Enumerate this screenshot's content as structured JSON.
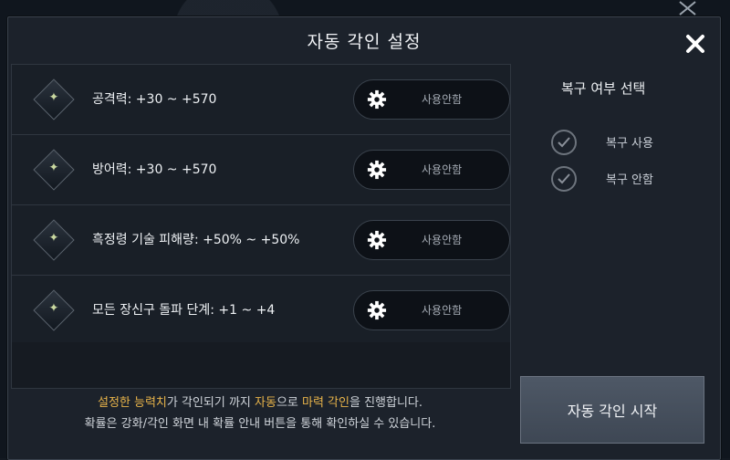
{
  "dialog": {
    "title": "자동 각인 설정",
    "close_icon": "close-icon"
  },
  "stats": [
    {
      "label": "공격력:  +30 ~  +570",
      "toggle_label": "사용안함"
    },
    {
      "label": "방어력:  +30 ~  +570",
      "toggle_label": "사용안함"
    },
    {
      "label": "흑정령 기술 피해량:  +50% ~  +50%",
      "toggle_label": "사용안함"
    },
    {
      "label": "모든 장신구 돌파 단계:  +1 ~  +4",
      "toggle_label": "사용안함"
    }
  ],
  "restore": {
    "title": "복구 여부 선택",
    "options": [
      {
        "label": "복구 사용"
      },
      {
        "label": "복구 안함"
      }
    ]
  },
  "info": {
    "line1_part1": "설정한 능력치",
    "line1_part2": "가 각인되기 까지 ",
    "line1_part3": "자동",
    "line1_part4": "으로 ",
    "line1_part5": "마력 각인",
    "line1_part6": "을 진행합니다.",
    "line2": "확률은 강화/각인 화면 내 확률 안내 버튼을 통해 확인하실 수 있습니다."
  },
  "start_button": "자동 각인 시작",
  "colors": {
    "highlight": "#e8b44a",
    "panel": "#1c222b"
  }
}
